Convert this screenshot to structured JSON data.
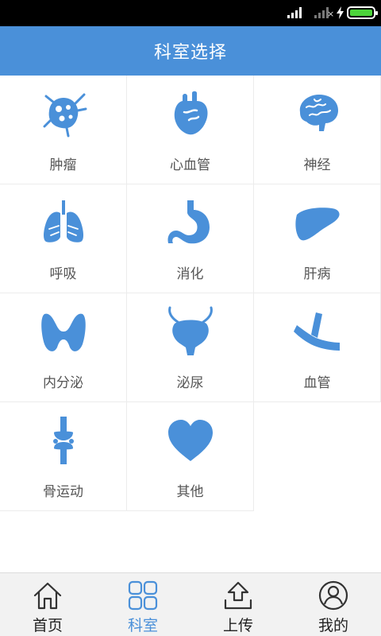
{
  "header": {
    "title": "科室选择"
  },
  "departments": [
    {
      "label": "肿瘤",
      "icon": "tumor-icon"
    },
    {
      "label": "心血管",
      "icon": "heart-organ-icon"
    },
    {
      "label": "神经",
      "icon": "brain-icon"
    },
    {
      "label": "呼吸",
      "icon": "lungs-icon"
    },
    {
      "label": "消化",
      "icon": "stomach-icon"
    },
    {
      "label": "肝病",
      "icon": "liver-icon"
    },
    {
      "label": "内分泌",
      "icon": "thyroid-icon"
    },
    {
      "label": "泌尿",
      "icon": "bladder-icon"
    },
    {
      "label": "血管",
      "icon": "blood-vessel-icon"
    },
    {
      "label": "骨运动",
      "icon": "bone-joint-icon"
    },
    {
      "label": "其他",
      "icon": "heart-icon"
    }
  ],
  "tabs": [
    {
      "label": "首页",
      "icon": "home-icon"
    },
    {
      "label": "科室",
      "icon": "grid-icon",
      "active": true
    },
    {
      "label": "上传",
      "icon": "upload-icon"
    },
    {
      "label": "我的",
      "icon": "user-icon"
    }
  ],
  "colors": {
    "accent": "#4a90d9",
    "battery": "#4cd43a"
  }
}
